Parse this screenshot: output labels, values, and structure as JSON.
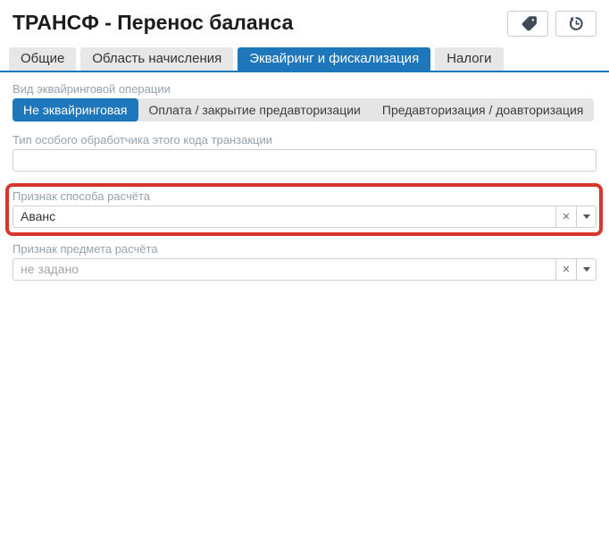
{
  "header": {
    "title": "ТРАНСФ - Перенос баланса",
    "actions": {
      "tags_tooltip": "",
      "history_tooltip": ""
    }
  },
  "icons": {
    "clear": "✕",
    "tag": "tag-icon",
    "history": "history-icon",
    "dropdown": "chevron-down-icon"
  },
  "tabs": [
    {
      "label": "Общие",
      "active": false
    },
    {
      "label": "Область начисления",
      "active": false
    },
    {
      "label": "Эквайринг и фискализация",
      "active": true
    },
    {
      "label": "Налоги",
      "active": false
    }
  ],
  "form": {
    "acquiring_operation_type": {
      "label": "Вид эквайринговой операции",
      "options": [
        "Не эквайринговая",
        "Оплата / закрытие предавторизации",
        "Предавторизация / доавторизация"
      ],
      "selected": "Не эквайринговая"
    },
    "special_handler": {
      "label": "Тип особого обработчика этого кода транзакции",
      "value": "",
      "placeholder": ""
    },
    "payment_method_attribute": {
      "label": "Признак способа расчёта",
      "value": "Аванс",
      "highlighted": true
    },
    "payment_subject_attribute": {
      "label": "Признак предмета расчёта",
      "value": "",
      "placeholder": "не задано"
    }
  },
  "colors": {
    "accent_blue": "#1e76bb",
    "highlight_red": "#d8362d",
    "label_gray": "#95a3af",
    "tab_inactive_bg": "#e7e7e7",
    "border_gray": "#cfcfcf",
    "icon_dark": "#3e4b57"
  }
}
